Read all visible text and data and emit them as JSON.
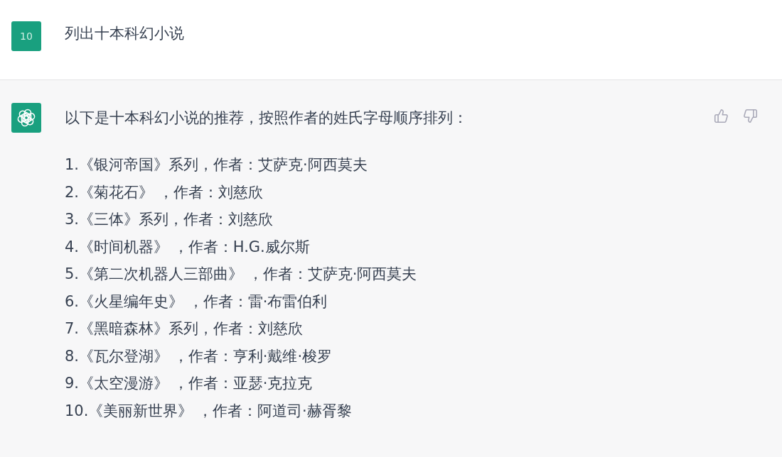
{
  "messages": [
    {
      "kind": "user",
      "avatar_label": "10",
      "text": "列出十本科幻小说"
    },
    {
      "kind": "assistant",
      "intro": "以下是十本科幻小说的推荐，按照作者的姓氏字母顺序排列：",
      "items": [
        "1.《银河帝国》系列，作者：艾萨克·阿西莫夫",
        "2.《菊花石》 ，作者：刘慈欣",
        "3.《三体》系列，作者：刘慈欣",
        "4.《时间机器》 ，作者：H.G.威尔斯",
        "5.《第二次机器人三部曲》 ，作者：艾萨克·阿西莫夫",
        "6.《火星编年史》 ，作者：雷·布雷伯利",
        "7.《黑暗森林》系列，作者：刘慈欣",
        "8.《瓦尔登湖》 ，作者：亨利·戴维·梭罗",
        "9.《太空漫游》 ，作者：亚瑟·克拉克",
        "10.《美丽新世界》 ，作者：阿道司·赫胥黎"
      ]
    }
  ]
}
